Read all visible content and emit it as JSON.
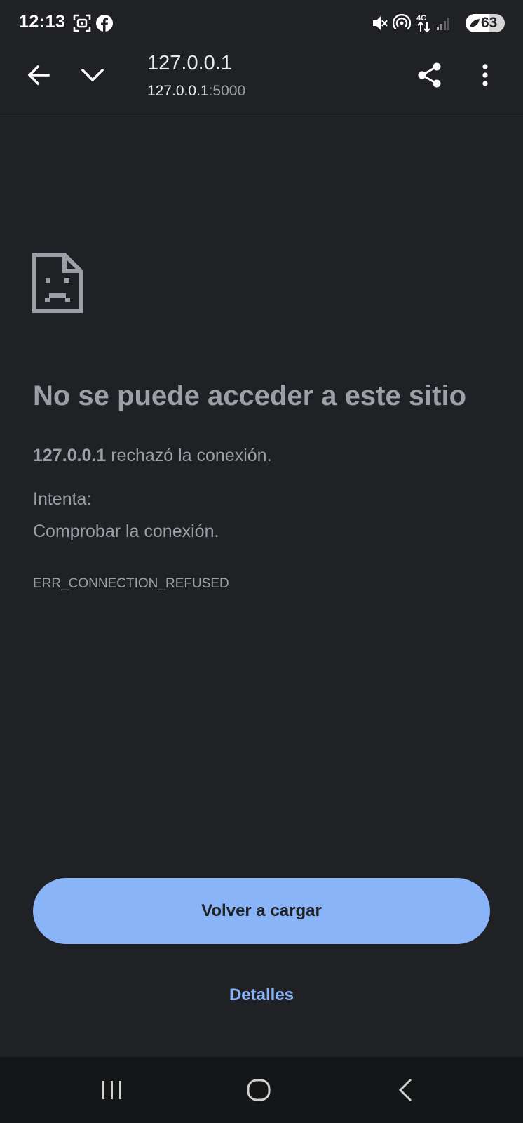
{
  "status_bar": {
    "time": "12:13",
    "battery_level": "63",
    "network_type": "4G",
    "icons": [
      "screenshot-icon",
      "facebook-icon",
      "muted-icon",
      "hotspot-icon",
      "mobile-data-icon",
      "signal-icon",
      "battery-icon"
    ]
  },
  "toolbar": {
    "title": "127.0.0.1",
    "url_host": "127.0.0.1",
    "url_port": ":5000",
    "icons": [
      "back-arrow-icon",
      "chevron-down-icon",
      "share-icon",
      "more-vert-icon"
    ]
  },
  "error": {
    "icon": "sad-page-icon",
    "heading": "No se puede acceder a este sitio",
    "host": "127.0.0.1",
    "message": " rechazó la conexión.",
    "try_label": "Intenta:",
    "try_item": "Comprobar la conexión.",
    "code": "ERR_CONNECTION_REFUSED"
  },
  "actions": {
    "reload_label": "Volver a cargar",
    "details_label": "Detalles"
  },
  "nav_bar": {
    "icons": [
      "recents-icon",
      "home-icon",
      "back-icon"
    ]
  },
  "colors": {
    "background": "#202124",
    "accent": "#8ab4f8",
    "muted_text": "#9aa0a6"
  }
}
